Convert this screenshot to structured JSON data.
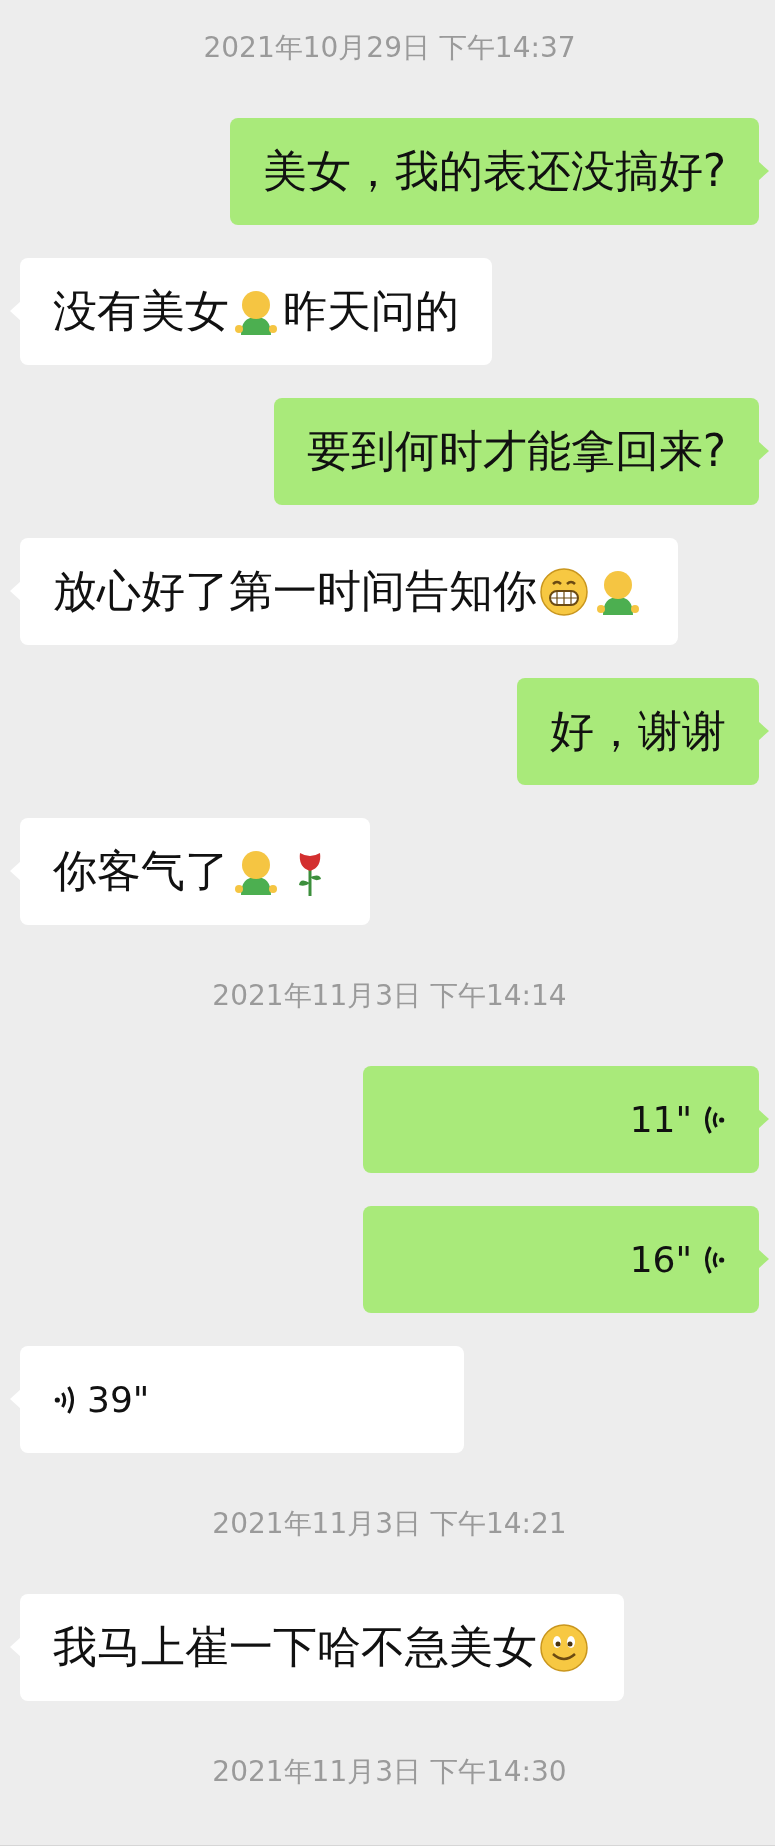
{
  "messages": [
    {
      "kind": "time",
      "text": "2021年10月29日 下午14:37"
    },
    {
      "kind": "text",
      "outgoing": true,
      "parts": [
        {
          "kind": "text",
          "text": "美女，我的表还没搞好?"
        }
      ]
    },
    {
      "kind": "text",
      "outgoing": false,
      "parts": [
        {
          "kind": "text",
          "text": "没有美女"
        },
        {
          "kind": "figure"
        },
        {
          "kind": "text",
          "text": "昨天问的"
        }
      ]
    },
    {
      "kind": "text",
      "outgoing": true,
      "parts": [
        {
          "kind": "text",
          "text": "要到何时才能拿回来?"
        }
      ]
    },
    {
      "kind": "text",
      "outgoing": false,
      "parts": [
        {
          "kind": "text",
          "text": "放心好了第一时间告知你"
        },
        {
          "kind": "grin"
        },
        {
          "kind": "figure"
        }
      ]
    },
    {
      "kind": "text",
      "outgoing": true,
      "parts": [
        {
          "kind": "text",
          "text": "好，谢谢"
        }
      ]
    },
    {
      "kind": "text",
      "outgoing": false,
      "parts": [
        {
          "kind": "text",
          "text": "你客气了"
        },
        {
          "kind": "figure"
        },
        {
          "kind": "rose"
        }
      ]
    },
    {
      "kind": "time",
      "text": "2021年11月3日 下午14:14"
    },
    {
      "kind": "voice",
      "outgoing": true,
      "duration": "11\""
    },
    {
      "kind": "voice",
      "outgoing": true,
      "duration": "16\""
    },
    {
      "kind": "voice",
      "outgoing": false,
      "duration": "39\""
    },
    {
      "kind": "time",
      "text": "2021年11月3日 下午14:21"
    },
    {
      "kind": "text",
      "outgoing": false,
      "parts": [
        {
          "kind": "text",
          "text": "我马上崔一下哈不急美女"
        },
        {
          "kind": "smile"
        }
      ]
    },
    {
      "kind": "time",
      "text": "2021年11月3日 下午14:30"
    }
  ]
}
